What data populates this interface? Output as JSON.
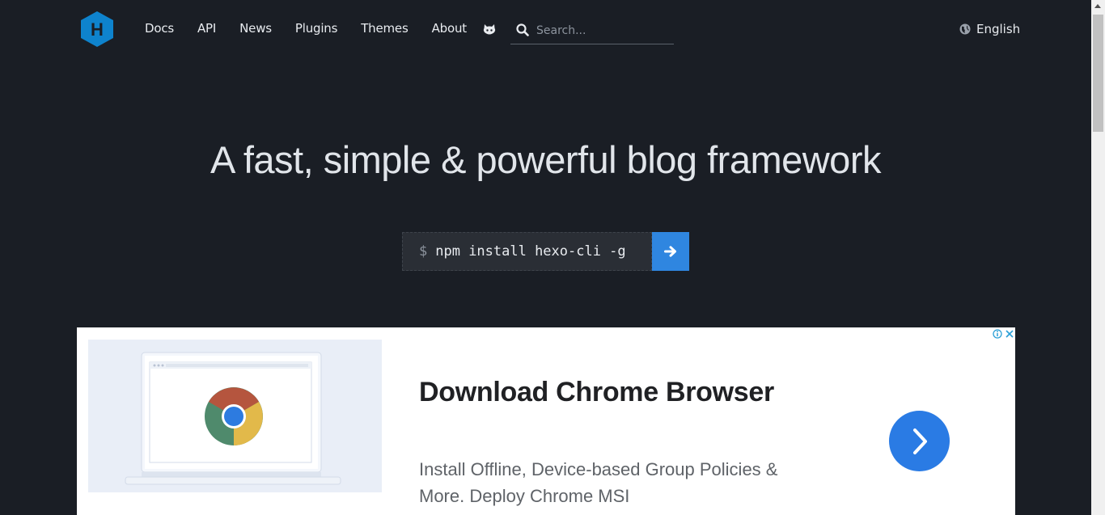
{
  "header": {
    "logo_letter": "H",
    "nav": [
      "Docs",
      "API",
      "News",
      "Plugins",
      "Themes",
      "About"
    ],
    "search_placeholder": "Search...",
    "language": "English"
  },
  "hero": {
    "title": "A fast, simple & powerful blog framework",
    "install_prompt": "$",
    "install_command": "npm install hexo-cli -g"
  },
  "ad": {
    "title": "Download Chrome Browser",
    "description": "Install Offline, Device-based Group Policies & More. Deploy Chrome MSI"
  },
  "colors": {
    "background": "#1a1e25",
    "accent": "#2f86e0",
    "logo": "#0e83cd"
  }
}
